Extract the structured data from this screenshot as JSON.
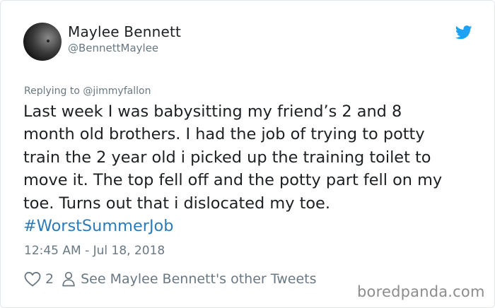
{
  "tweet": {
    "author_name": "Maylee Bennett",
    "author_handle": "@BennettMaylee",
    "replying_to": "Replying to @jimmyfallon",
    "text_lines": [
      "Last week I was babysitting my friend’s 2 and 8",
      "month old brothers. I had the job of trying to potty",
      "train the 2 year old i picked up the training toilet to",
      "move it. The top fell off and the potty part fell on my",
      "toe. Turns out that i dislocated my toe."
    ],
    "hashtag": "#WorstSummerJob",
    "timestamp": "12:45 AM - Jul 18, 2018",
    "likes_count": "2",
    "other_tweets_link": "See Maylee Bennett's other Tweets"
  },
  "watermark": "boredpanda.com",
  "icons": {
    "brand": "twitter-bird-icon",
    "like": "heart-outline-icon",
    "profile": "person-outline-icon"
  },
  "colors": {
    "text": "#1c2022",
    "secondary": "#697882",
    "link": "#2b7bb9",
    "brand": "#1da1f2"
  }
}
